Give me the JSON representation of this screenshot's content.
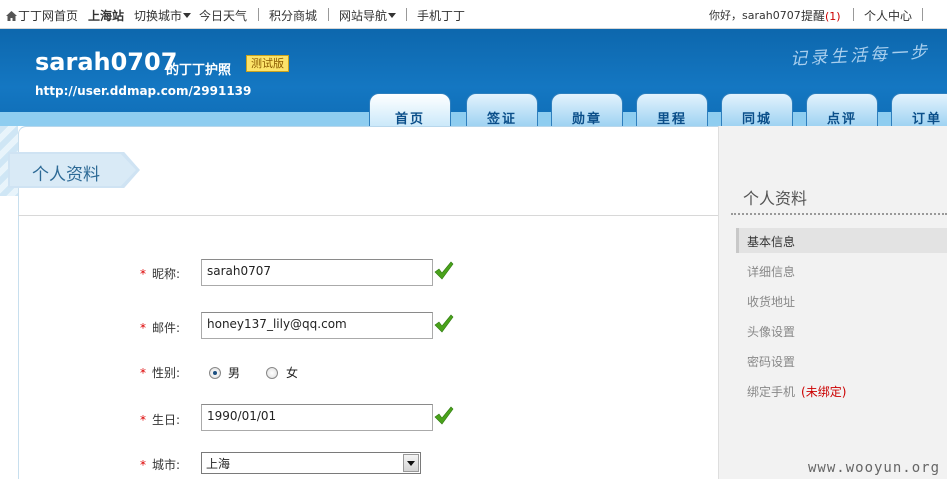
{
  "topbar": {
    "home": "丁丁网首页",
    "city": "上海站",
    "switch_city": "切换城市",
    "weather": "今日天气",
    "points_mall": "积分商城",
    "site_nav": "网站导航",
    "mobile": "手机丁丁",
    "greeting": "你好，sarah0707",
    "remind": "提醒",
    "remind_count": "(1)",
    "personal_center": "个人中心"
  },
  "header": {
    "username": "sarah0707",
    "passport": "的丁丁护照",
    "beta": "测试版",
    "url": "http://user.ddmap.com/2991139",
    "slogan": "记录生活每一步",
    "tabs": [
      "首页",
      "签证",
      "勋章",
      "里程",
      "同城",
      "点评",
      "订单"
    ]
  },
  "main": {
    "title": "个人资料",
    "form": {
      "nickname_label": "昵称:",
      "nickname_value": "sarah0707",
      "email_label": "邮件:",
      "email_value": "honey137_lily@qq.com",
      "gender_label": "性别:",
      "gender_male": "男",
      "gender_female": "女",
      "birthday_label": "生日:",
      "birthday_value": "1990/01/01",
      "city_label": "城市:",
      "city_value": "上海"
    }
  },
  "sidebar": {
    "title": "个人资料",
    "items": [
      "基本信息",
      "详细信息",
      "收货地址",
      "头像设置",
      "密码设置",
      "绑定手机"
    ],
    "unbound": "(未绑定)"
  },
  "watermark": "www.wooyun.org",
  "colors": {
    "header_blue": "#1477c2",
    "required_star": "#dd0000",
    "check_green": "#4aa21b"
  }
}
